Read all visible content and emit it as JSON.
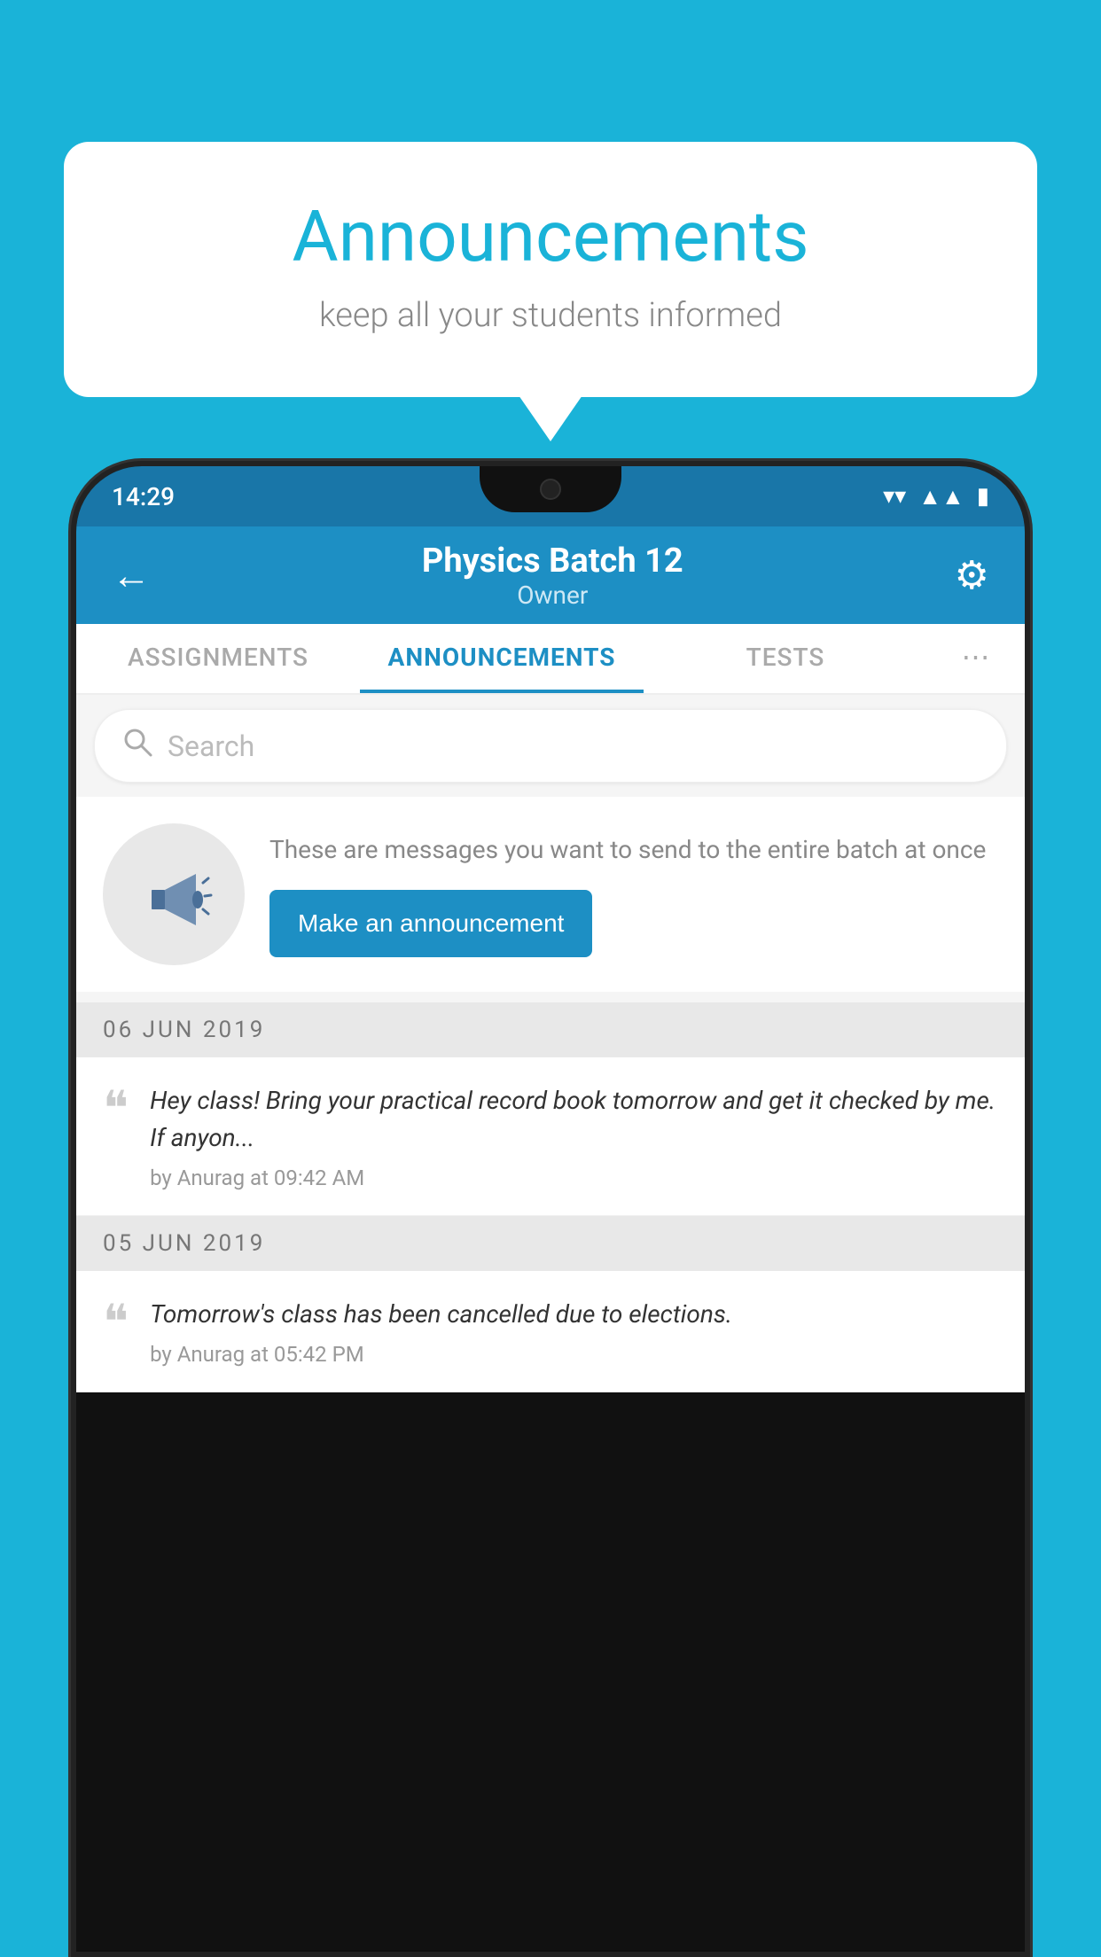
{
  "background_color": "#1ab3d8",
  "speech_bubble": {
    "title": "Announcements",
    "subtitle": "keep all your students informed"
  },
  "phone": {
    "status_bar": {
      "time": "14:29",
      "icons": [
        "wifi",
        "signal",
        "battery"
      ]
    },
    "header": {
      "title": "Physics Batch 12",
      "subtitle": "Owner",
      "back_label": "←",
      "gear_label": "⚙"
    },
    "tabs": [
      {
        "label": "ASSIGNMENTS",
        "active": false
      },
      {
        "label": "ANNOUNCEMENTS",
        "active": true
      },
      {
        "label": "TESTS",
        "active": false
      },
      {
        "label": "⋯",
        "active": false
      }
    ],
    "search": {
      "placeholder": "Search"
    },
    "promo": {
      "description": "These are messages you want to send to the entire batch at once",
      "button_label": "Make an announcement"
    },
    "announcements": [
      {
        "date": "06  JUN  2019",
        "message": "Hey class! Bring your practical record book tomorrow and get it checked by me. If anyon...",
        "meta": "by Anurag at 09:42 AM"
      },
      {
        "date": "05  JUN  2019",
        "message": "Tomorrow's class has been cancelled due to elections.",
        "meta": "by Anurag at 05:42 PM"
      }
    ]
  }
}
